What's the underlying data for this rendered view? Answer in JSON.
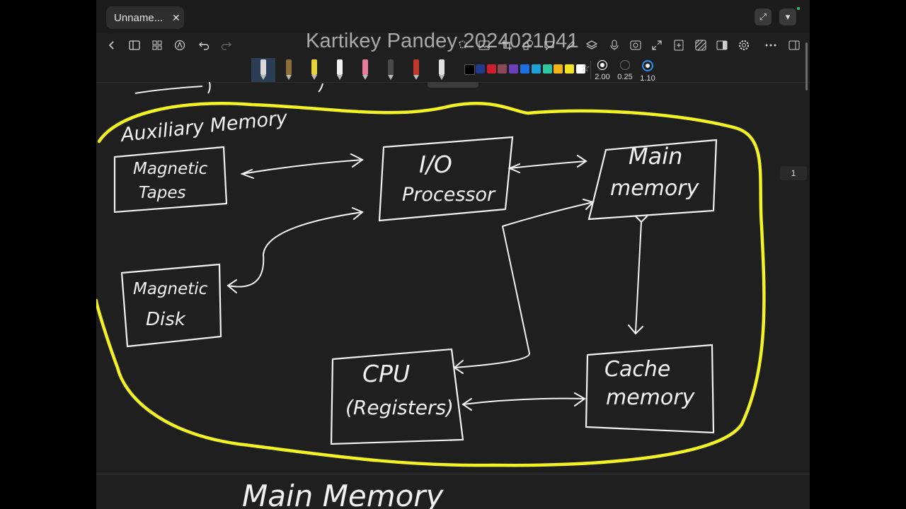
{
  "tab": {
    "title": "Unname...",
    "close_glyph": "✕"
  },
  "window": {
    "expand_glyph": "⤢",
    "menu_glyph": "▾"
  },
  "watermark": "Kartikey Pandey 2024021041",
  "toolbar_icons": [
    "chevron-left-icon",
    "sidebar-icon",
    "grid-icon",
    "pen-nib-icon",
    "undo-icon",
    "redo-icon",
    "lasso-icon",
    "image-icon",
    "crop-icon",
    "shapes-icon",
    "highlighter-icon",
    "comment-icon",
    "layers-icon",
    "microphone-icon",
    "photo-icon",
    "expand-icon",
    "add-page-icon",
    "pattern-icon",
    "split-view-icon",
    "settings-icon",
    "more-icon",
    "panel-icon"
  ],
  "pens": [
    {
      "name": "fountain-pen",
      "color": "#d9d9d9",
      "selected": true
    },
    {
      "name": "pencil",
      "color": "#8a6d3b"
    },
    {
      "name": "highlighter-yellow",
      "color": "#e6d23a"
    },
    {
      "name": "eraser",
      "color": "#f2f2f2"
    },
    {
      "name": "marker-pink",
      "color": "#e57c9a"
    },
    {
      "name": "brush-pen",
      "color": "#4a4a4a"
    },
    {
      "name": "marker-red",
      "color": "#c0392b"
    },
    {
      "name": "ballpoint",
      "color": "#e0e0e0"
    }
  ],
  "colors": [
    "#000000",
    "#233a8c",
    "#cc1f2d",
    "#8b4a56",
    "#6a3fb8",
    "#1f6fe0",
    "#1ea2d6",
    "#2ec7a2",
    "#f2b418",
    "#f2e224",
    "#ffffff"
  ],
  "stroke_widths": [
    {
      "label": "2.00",
      "selected": false
    },
    {
      "label": "0.25",
      "selected": false
    },
    {
      "label": "1.10",
      "selected": true
    }
  ],
  "page_number": "1",
  "diagram": {
    "title": "Auxiliary Memory",
    "nodes": {
      "tapes": [
        "Magnetic",
        "Tapes"
      ],
      "io": [
        "I/O",
        "Processor"
      ],
      "main": [
        "Main",
        "memory"
      ],
      "disk": [
        "Magnetic",
        "Disk"
      ],
      "cpu": [
        "CPU",
        "(Registers)"
      ],
      "cache": [
        "Cache",
        "memory"
      ]
    },
    "outline_color": "#f2f224"
  },
  "next_heading": "Main Memory"
}
